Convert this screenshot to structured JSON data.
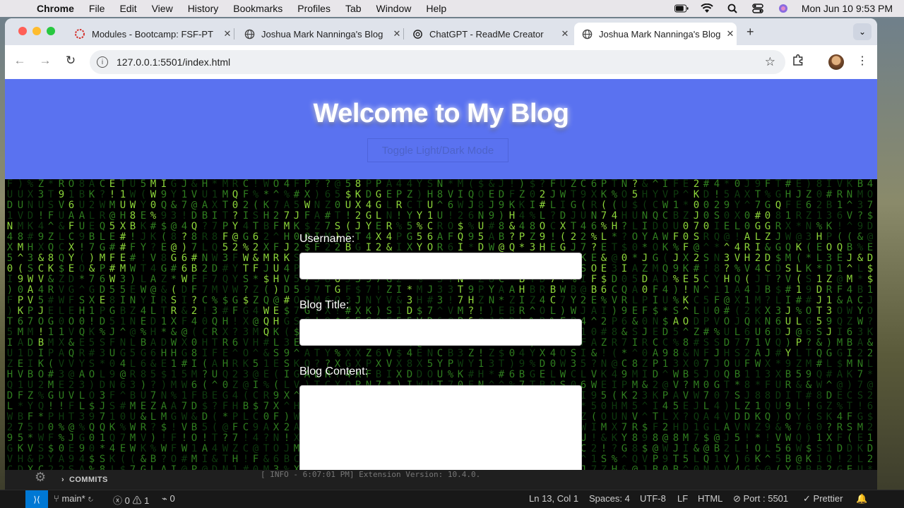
{
  "menubar": {
    "app": "Chrome",
    "items": [
      "File",
      "Edit",
      "View",
      "History",
      "Bookmarks",
      "Profiles",
      "Tab",
      "Window",
      "Help"
    ],
    "clock": "Mon Jun 10  9:53 PM"
  },
  "browser": {
    "tabs": [
      {
        "title": "Modules - Bootcamp: FSF-PT"
      },
      {
        "title": "Joshua Mark Nanninga's Blog"
      },
      {
        "title": "ChatGPT - ReadMe Creator"
      },
      {
        "title": "Joshua Mark Nanninga's Blog"
      }
    ],
    "url": "127.0.0.1:5501/index.html"
  },
  "page": {
    "heading": "Welcome to My Blog",
    "toggle_label": "Toggle Light/Dark Mode",
    "form": {
      "username_label": "Username:",
      "title_label": "Blog Title:",
      "content_label": "Blog Content:"
    }
  },
  "vscode": {
    "commits_label": "COMMITS",
    "log_line": "[ INFO - 6:07:01 PM] Extension Version: 10.4.0.",
    "status": {
      "branch": "main*",
      "errors": "0",
      "warnings": "1",
      "ports": "0",
      "position": "Ln 13, Col 1",
      "spaces": "Spaces: 4",
      "encoding": "UTF-8",
      "eol": "LF",
      "language": "HTML",
      "port": "Port : 5501",
      "formatter": "Prettier"
    }
  },
  "colors": {
    "hero": "#5a72f0",
    "matrix_green": "#8cd63a",
    "vscode_accent": "#0078d4"
  }
}
